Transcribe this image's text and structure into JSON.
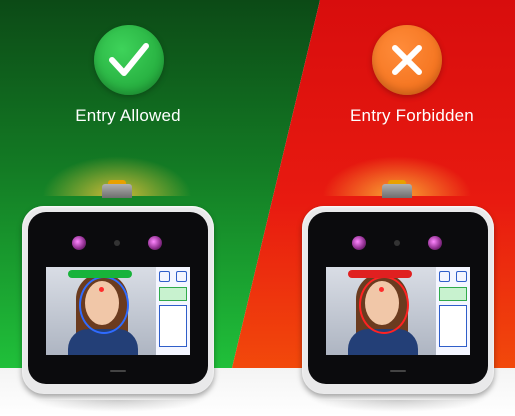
{
  "left_panel": {
    "caption": "Entry Allowed",
    "icon": "check-icon",
    "badge_color": "#22a83c",
    "background_color": "#137a24"
  },
  "right_panel": {
    "caption": "Entry Forbidden",
    "icon": "x-icon",
    "badge_color": "#f47320",
    "background_color": "#e81a10"
  }
}
